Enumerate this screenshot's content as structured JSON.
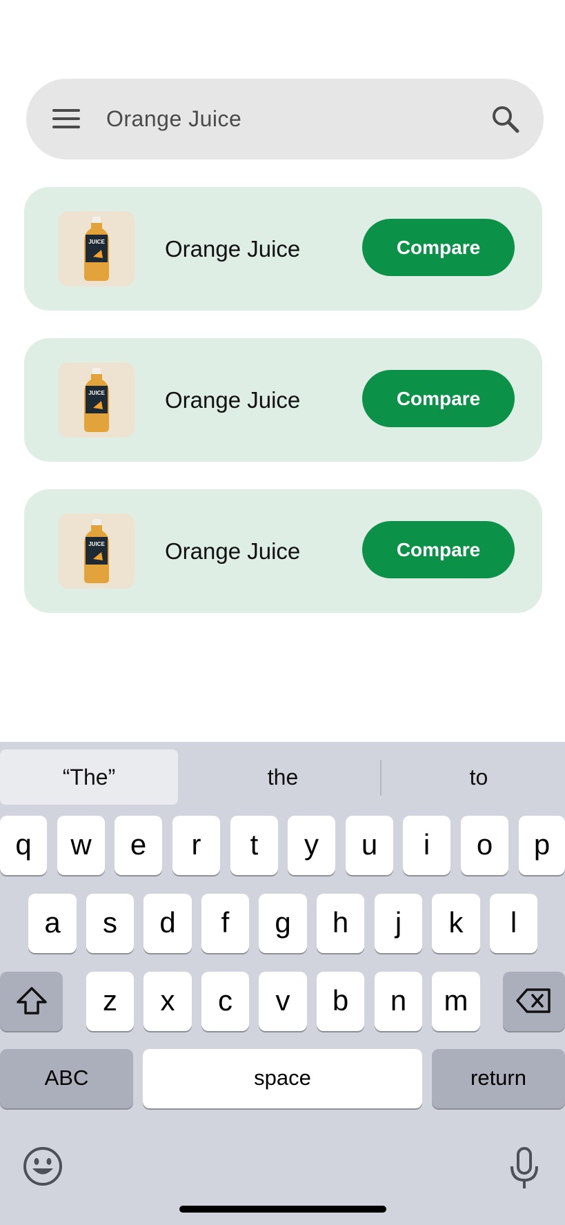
{
  "search": {
    "query": "Orange Juice",
    "menu_icon": "hamburger-menu-icon",
    "search_icon": "search-icon"
  },
  "results": [
    {
      "title": "Orange Juice",
      "button_label": "Compare",
      "image_label": "JUICE"
    },
    {
      "title": "Orange Juice",
      "button_label": "Compare",
      "image_label": "JUICE"
    },
    {
      "title": "Orange Juice",
      "button_label": "Compare",
      "image_label": "JUICE"
    }
  ],
  "keyboard": {
    "suggestions": [
      "“The”",
      "the",
      "to"
    ],
    "row1": [
      "q",
      "w",
      "e",
      "r",
      "t",
      "y",
      "u",
      "i",
      "o",
      "p"
    ],
    "row2": [
      "a",
      "s",
      "d",
      "f",
      "g",
      "h",
      "j",
      "k",
      "l"
    ],
    "row3": [
      "z",
      "x",
      "c",
      "v",
      "b",
      "n",
      "m"
    ],
    "abc_label": "ABC",
    "space_label": "space",
    "return_label": "return",
    "shift_icon": "shift-icon",
    "backspace_icon": "backspace-icon",
    "emoji_icon": "emoji-icon",
    "mic_icon": "microphone-icon"
  },
  "colors": {
    "accent": "#0b9148",
    "card_bg": "#deeee5",
    "search_bg": "#e6e6e6",
    "keyboard_bg": "#d1d4dc"
  }
}
